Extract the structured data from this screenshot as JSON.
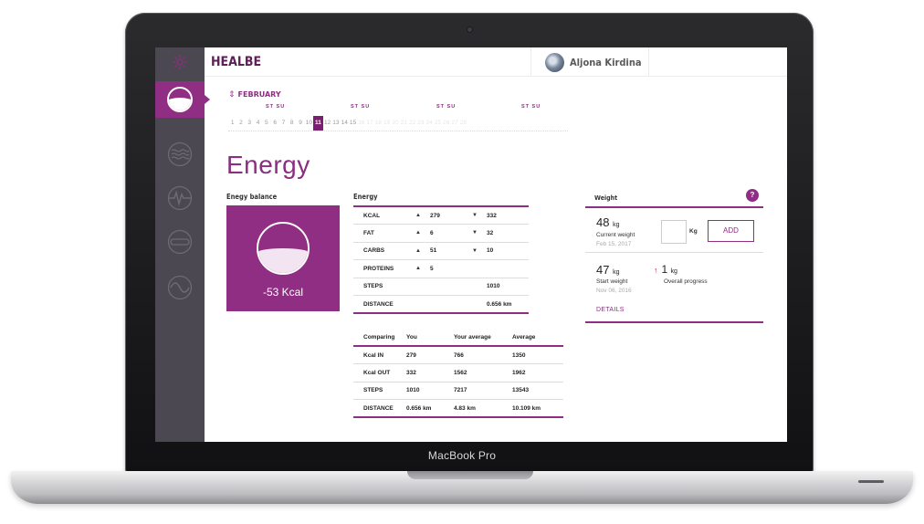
{
  "device": {
    "brand_text": "MacBook Pro"
  },
  "app": {
    "title": "HEALBE"
  },
  "user": {
    "name": "Aljona Kirdina"
  },
  "sidebar": {
    "items": [
      {
        "name": "energy",
        "icon": "energy-gauge-icon",
        "active": true
      },
      {
        "name": "water-balance",
        "icon": "waves-icon",
        "active": false
      },
      {
        "name": "heart-rate",
        "icon": "pulse-icon",
        "active": false
      },
      {
        "name": "sleep",
        "icon": "capsule-icon",
        "active": false
      },
      {
        "name": "stress",
        "icon": "sine-wave-icon",
        "active": false
      }
    ]
  },
  "calendar": {
    "month": "FEBRUARY",
    "weekend_labels": [
      "ST SU",
      "ST SU",
      "ST SU",
      "ST SU"
    ],
    "days": [
      "1",
      "2",
      "3",
      "4",
      "5",
      "6",
      "7",
      "8",
      "9",
      "10",
      "11",
      "12",
      "13",
      "14",
      "15",
      "16",
      "17",
      "18",
      "19",
      "20",
      "21",
      "22",
      "23",
      "24",
      "25",
      "26",
      "27",
      "28"
    ],
    "selected_day": "11",
    "last_day_with_data": 15
  },
  "page": {
    "title": "Energy"
  },
  "energy_balance": {
    "heading": "Enegy balance",
    "value": "-53 Kcal",
    "fill_fraction": 0.54
  },
  "energy": {
    "heading": "Energy",
    "rows": [
      {
        "label": "KCAL",
        "up": "▲",
        "v1": "279",
        "down": "▼",
        "v2": "332"
      },
      {
        "label": "FAT",
        "up": "▲",
        "v1": "6",
        "down": "▼",
        "v2": "32"
      },
      {
        "label": "CARBS",
        "up": "▲",
        "v1": "51",
        "down": "▼",
        "v2": "10"
      },
      {
        "label": "PROTEINS",
        "up": "▲",
        "v1": "5",
        "down": "",
        "v2": ""
      },
      {
        "label": "STEPS",
        "up": "",
        "v1": "",
        "down": "",
        "v2": "1010"
      },
      {
        "label": "DISTANCE",
        "up": "",
        "v1": "",
        "down": "",
        "v2": "0.656 km"
      }
    ]
  },
  "comparing": {
    "headers": [
      "Comparing",
      "You",
      "Your average",
      "Average"
    ],
    "rows": [
      [
        "Kcal IN",
        "279",
        "766",
        "1350"
      ],
      [
        "Kcal OUT",
        "332",
        "1562",
        "1962"
      ],
      [
        "STEPS",
        "1010",
        "7217",
        "13543"
      ],
      [
        "DISTANCE",
        "0.656 km",
        "4.83 km",
        "10.109 km"
      ]
    ]
  },
  "weight": {
    "heading": "Weight",
    "help": "?",
    "current": {
      "value": "48",
      "unit": "kg",
      "label": "Current weight",
      "date": "Feb 15, 2017"
    },
    "input_unit": "Kg",
    "add_label": "ADD",
    "start": {
      "value": "47",
      "unit": "kg",
      "label": "Start weight",
      "date": "Nov 06, 2016"
    },
    "progress": {
      "arrow": "↑",
      "value": "1",
      "unit": "kg",
      "label": "Overall progress"
    },
    "details_label": "DETAILS"
  },
  "colors": {
    "accent": "#8f2e83",
    "sidebar": "#4b4851",
    "title": "#5d2157"
  }
}
